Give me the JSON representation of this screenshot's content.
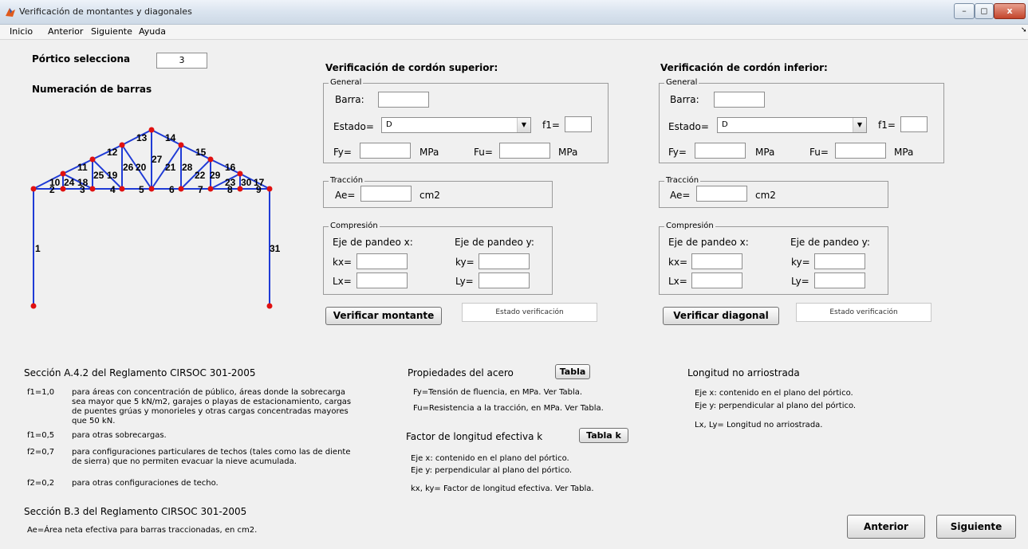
{
  "window": {
    "title": "Verificación de montantes y diagonales",
    "min": "–",
    "max": "◻",
    "close": "x"
  },
  "menu": [
    "Inicio",
    "Anterior",
    "Siguiente",
    "Ayuda"
  ],
  "left": {
    "portico_label": "Pórtico selecciona",
    "portico_value": "3",
    "numeracion_label": "Numeración de barras"
  },
  "truss_labels": [
    "1",
    "2",
    "3",
    "4",
    "5",
    "6",
    "7",
    "8",
    "9",
    "10",
    "11",
    "12",
    "13",
    "14",
    "15",
    "16",
    "17",
    "18",
    "19",
    "20",
    "21",
    "22",
    "23",
    "24",
    "25",
    "26",
    "27",
    "28",
    "29",
    "30",
    "31"
  ],
  "superior": {
    "title": "Verificación de cordón superior:",
    "general": "General",
    "barra": "Barra:",
    "estado": "Estado=",
    "estado_value": "D",
    "f1": "f1=",
    "fy": "Fy=",
    "fu": "Fu=",
    "mpa": "MPa",
    "traccion": "Tracción",
    "ae": "Ae=",
    "cm2": "cm2",
    "compresion": "Compresión",
    "eje_x": "Eje de pandeo x:",
    "eje_y": "Eje de pandeo y:",
    "kx": "kx=",
    "ky": "ky=",
    "lx": "Lx=",
    "ly": "Ly=",
    "button": "Verificar montante",
    "status": "Estado verificación"
  },
  "inferior": {
    "title": "Verificación de cordón inferior:",
    "general": "General",
    "barra": "Barra:",
    "estado": "Estado=",
    "estado_value": "D",
    "f1": "f1=",
    "fy": "Fy=",
    "fu": "Fu=",
    "mpa": "MPa",
    "traccion": "Tracción",
    "ae": "Ae=",
    "cm2": "cm2",
    "compresion": "Compresión",
    "eje_x": "Eje de pandeo x:",
    "eje_y": "Eje de pandeo y:",
    "kx": "kx=",
    "ky": "ky=",
    "lx": "Lx=",
    "ly": "Ly=",
    "button": "Verificar diagonal",
    "status": "Estado verificación"
  },
  "cirsoc": {
    "seccion_a": "Sección A.4.2 del Reglamento CIRSOC 301-2005",
    "f1_10": "f1=1,0",
    "f1_10_text": "para áreas con concentración de público, áreas donde la sobrecarga sea mayor que 5 kN/m2, garajes o playas de estacionamiento, cargas de puentes grúas y monorieles y otras cargas concentradas mayores que 50 kN.",
    "f1_05": "f1=0,5",
    "f1_05_text": "para otras sobrecargas.",
    "f2_07": "f2=0,7",
    "f2_07_text": "para configuraciones particulares de techos (tales como las de diente de sierra) que no permiten evacuar la nieve acumulada.",
    "f2_02": "f2=0,2",
    "f2_02_text": "para otras configuraciones de techo.",
    "seccion_b": "Sección B.3 del Reglamento CIRSOC 301-2005",
    "ae_text": "Ae=Área neta efectiva para barras traccionadas, en cm2."
  },
  "acero": {
    "title": "Propiedades del acero",
    "tabla_btn": "Tabla",
    "fy_text": "Fy=Tensión de fluencia, en MPa. Ver Tabla.",
    "fu_text": "Fu=Resistencia a la tracción, en MPa. Ver Tabla.",
    "factor_title": "Factor de longitud efectiva k",
    "tablak_btn": "Tabla k",
    "eje_x": "Eje x: contenido en el plano del pórtico.",
    "eje_y": "Eje y: perpendicular al plano del pórtico.",
    "kxky": "kx, ky= Factor de longitud efectiva. Ver Tabla."
  },
  "longitud": {
    "title": "Longitud no arriostrada",
    "eje_x": "Eje x: contenido en el plano del pórtico.",
    "eje_y": "Eje y: perpendicular al plano del pórtico.",
    "lxly": "Lx, Ly= Longitud no arriostrada."
  },
  "nav": {
    "anterior": "Anterior",
    "siguiente": "Siguiente"
  },
  "colors": {
    "truss_line": "#1f3bd6",
    "truss_node": "#e01010"
  }
}
